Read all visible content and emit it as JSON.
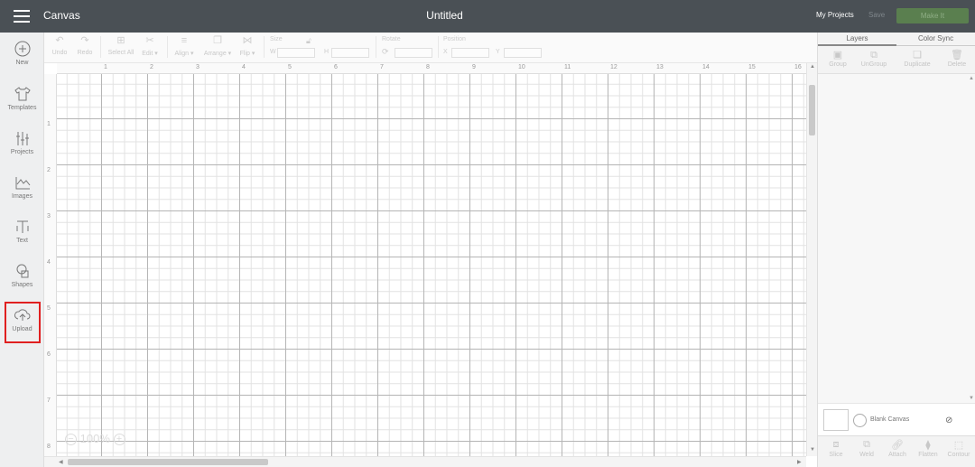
{
  "topbar": {
    "app_title": "Canvas",
    "doc_title": "Untitled",
    "my_projects": "My Projects",
    "save": "Save",
    "make_it": "Make It"
  },
  "sidebar": {
    "items": [
      {
        "label": "New",
        "icon": "plus-circle-icon"
      },
      {
        "label": "Templates",
        "icon": "shirt-icon"
      },
      {
        "label": "Projects",
        "icon": "projects-icon"
      },
      {
        "label": "Images",
        "icon": "image-icon"
      },
      {
        "label": "Text",
        "icon": "text-icon"
      },
      {
        "label": "Shapes",
        "icon": "shapes-icon"
      },
      {
        "label": "Upload",
        "icon": "upload-cloud-icon"
      }
    ],
    "highlight_color": "#e02020"
  },
  "toolbar": {
    "undo": "Undo",
    "redo": "Redo",
    "select_all": "Select All",
    "edit": "Edit ▾",
    "align": "Align ▾",
    "arrange": "Arrange ▾",
    "flip": "Flip ▾",
    "size_label": "Size",
    "w": "W",
    "h": "H",
    "rotate_label": "Rotate",
    "position_label": "Position",
    "x": "X",
    "y": "Y"
  },
  "canvas": {
    "ruler_top": [
      "1",
      "2",
      "3",
      "4",
      "5",
      "6",
      "7",
      "8",
      "9",
      "10",
      "11",
      "12",
      "13",
      "14",
      "15",
      "16"
    ],
    "ruler_left": [
      "1",
      "2",
      "3",
      "4",
      "5",
      "6",
      "7",
      "8"
    ],
    "zoom_minus": "−",
    "zoom_level": "100%",
    "zoom_plus": "+"
  },
  "panel": {
    "tabs": [
      "Layers",
      "Color Sync"
    ],
    "layer_tools": [
      "Group",
      "UnGroup",
      "Duplicate",
      "Delete"
    ],
    "blank_canvas": "Blank Canvas",
    "bottom_tools": [
      "Slice",
      "Weld",
      "Attach",
      "Flatten",
      "Contour"
    ]
  },
  "colors": {
    "topbar": "#4a5055",
    "make_it": "#5a7f4f"
  }
}
